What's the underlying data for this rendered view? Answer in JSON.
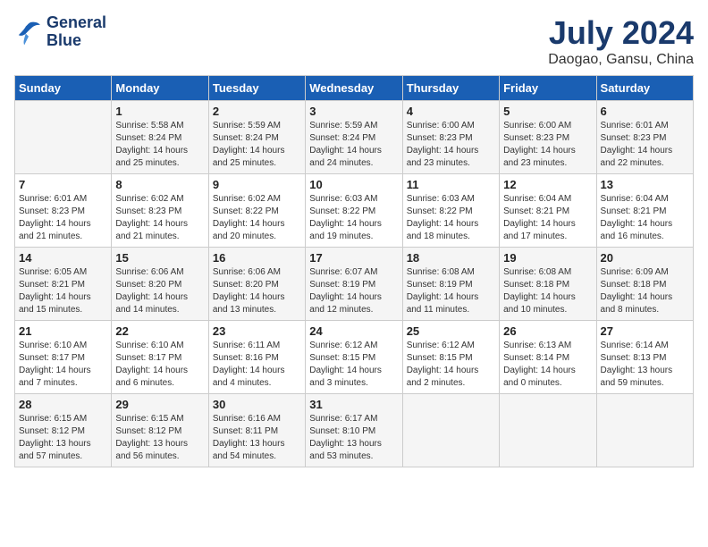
{
  "logo": {
    "line1": "General",
    "line2": "Blue"
  },
  "title": "July 2024",
  "subtitle": "Daogao, Gansu, China",
  "header_days": [
    "Sunday",
    "Monday",
    "Tuesday",
    "Wednesday",
    "Thursday",
    "Friday",
    "Saturday"
  ],
  "weeks": [
    [
      {
        "day": "",
        "info": ""
      },
      {
        "day": "1",
        "info": "Sunrise: 5:58 AM\nSunset: 8:24 PM\nDaylight: 14 hours\nand 25 minutes."
      },
      {
        "day": "2",
        "info": "Sunrise: 5:59 AM\nSunset: 8:24 PM\nDaylight: 14 hours\nand 25 minutes."
      },
      {
        "day": "3",
        "info": "Sunrise: 5:59 AM\nSunset: 8:24 PM\nDaylight: 14 hours\nand 24 minutes."
      },
      {
        "day": "4",
        "info": "Sunrise: 6:00 AM\nSunset: 8:23 PM\nDaylight: 14 hours\nand 23 minutes."
      },
      {
        "day": "5",
        "info": "Sunrise: 6:00 AM\nSunset: 8:23 PM\nDaylight: 14 hours\nand 23 minutes."
      },
      {
        "day": "6",
        "info": "Sunrise: 6:01 AM\nSunset: 8:23 PM\nDaylight: 14 hours\nand 22 minutes."
      }
    ],
    [
      {
        "day": "7",
        "info": "Sunrise: 6:01 AM\nSunset: 8:23 PM\nDaylight: 14 hours\nand 21 minutes."
      },
      {
        "day": "8",
        "info": "Sunrise: 6:02 AM\nSunset: 8:23 PM\nDaylight: 14 hours\nand 21 minutes."
      },
      {
        "day": "9",
        "info": "Sunrise: 6:02 AM\nSunset: 8:22 PM\nDaylight: 14 hours\nand 20 minutes."
      },
      {
        "day": "10",
        "info": "Sunrise: 6:03 AM\nSunset: 8:22 PM\nDaylight: 14 hours\nand 19 minutes."
      },
      {
        "day": "11",
        "info": "Sunrise: 6:03 AM\nSunset: 8:22 PM\nDaylight: 14 hours\nand 18 minutes."
      },
      {
        "day": "12",
        "info": "Sunrise: 6:04 AM\nSunset: 8:21 PM\nDaylight: 14 hours\nand 17 minutes."
      },
      {
        "day": "13",
        "info": "Sunrise: 6:04 AM\nSunset: 8:21 PM\nDaylight: 14 hours\nand 16 minutes."
      }
    ],
    [
      {
        "day": "14",
        "info": "Sunrise: 6:05 AM\nSunset: 8:21 PM\nDaylight: 14 hours\nand 15 minutes."
      },
      {
        "day": "15",
        "info": "Sunrise: 6:06 AM\nSunset: 8:20 PM\nDaylight: 14 hours\nand 14 minutes."
      },
      {
        "day": "16",
        "info": "Sunrise: 6:06 AM\nSunset: 8:20 PM\nDaylight: 14 hours\nand 13 minutes."
      },
      {
        "day": "17",
        "info": "Sunrise: 6:07 AM\nSunset: 8:19 PM\nDaylight: 14 hours\nand 12 minutes."
      },
      {
        "day": "18",
        "info": "Sunrise: 6:08 AM\nSunset: 8:19 PM\nDaylight: 14 hours\nand 11 minutes."
      },
      {
        "day": "19",
        "info": "Sunrise: 6:08 AM\nSunset: 8:18 PM\nDaylight: 14 hours\nand 10 minutes."
      },
      {
        "day": "20",
        "info": "Sunrise: 6:09 AM\nSunset: 8:18 PM\nDaylight: 14 hours\nand 8 minutes."
      }
    ],
    [
      {
        "day": "21",
        "info": "Sunrise: 6:10 AM\nSunset: 8:17 PM\nDaylight: 14 hours\nand 7 minutes."
      },
      {
        "day": "22",
        "info": "Sunrise: 6:10 AM\nSunset: 8:17 PM\nDaylight: 14 hours\nand 6 minutes."
      },
      {
        "day": "23",
        "info": "Sunrise: 6:11 AM\nSunset: 8:16 PM\nDaylight: 14 hours\nand 4 minutes."
      },
      {
        "day": "24",
        "info": "Sunrise: 6:12 AM\nSunset: 8:15 PM\nDaylight: 14 hours\nand 3 minutes."
      },
      {
        "day": "25",
        "info": "Sunrise: 6:12 AM\nSunset: 8:15 PM\nDaylight: 14 hours\nand 2 minutes."
      },
      {
        "day": "26",
        "info": "Sunrise: 6:13 AM\nSunset: 8:14 PM\nDaylight: 14 hours\nand 0 minutes."
      },
      {
        "day": "27",
        "info": "Sunrise: 6:14 AM\nSunset: 8:13 PM\nDaylight: 13 hours\nand 59 minutes."
      }
    ],
    [
      {
        "day": "28",
        "info": "Sunrise: 6:15 AM\nSunset: 8:12 PM\nDaylight: 13 hours\nand 57 minutes."
      },
      {
        "day": "29",
        "info": "Sunrise: 6:15 AM\nSunset: 8:12 PM\nDaylight: 13 hours\nand 56 minutes."
      },
      {
        "day": "30",
        "info": "Sunrise: 6:16 AM\nSunset: 8:11 PM\nDaylight: 13 hours\nand 54 minutes."
      },
      {
        "day": "31",
        "info": "Sunrise: 6:17 AM\nSunset: 8:10 PM\nDaylight: 13 hours\nand 53 minutes."
      },
      {
        "day": "",
        "info": ""
      },
      {
        "day": "",
        "info": ""
      },
      {
        "day": "",
        "info": ""
      }
    ]
  ]
}
